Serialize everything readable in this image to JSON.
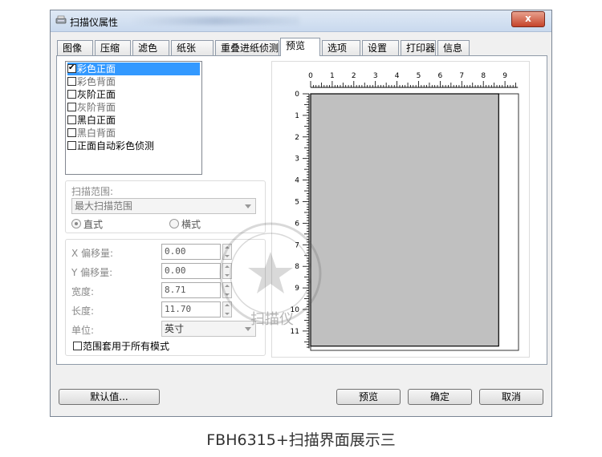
{
  "window": {
    "title": "扫描仪属性",
    "close_label": "x"
  },
  "tabs": [
    "图像",
    "压缩",
    "滤色",
    "纸张",
    "重叠进纸侦测",
    "预览",
    "选项",
    "设置",
    "打印器",
    "信息"
  ],
  "active_tab": "预览",
  "image_list": [
    {
      "label": "彩色正面",
      "checked": true,
      "selected": true,
      "enabled": true
    },
    {
      "label": "彩色背面",
      "checked": false,
      "selected": false,
      "enabled": false
    },
    {
      "label": "灰阶正面",
      "checked": false,
      "selected": false,
      "enabled": true
    },
    {
      "label": "灰阶背面",
      "checked": false,
      "selected": false,
      "enabled": false
    },
    {
      "label": "黑白正面",
      "checked": false,
      "selected": false,
      "enabled": true
    },
    {
      "label": "黑白背面",
      "checked": false,
      "selected": false,
      "enabled": false
    },
    {
      "label": "正面自动彩色侦测",
      "checked": false,
      "selected": false,
      "enabled": true
    }
  ],
  "scan_area": {
    "label": "扫描范围:",
    "value": "最大扫描范围",
    "portrait_label": "直式",
    "landscape_label": "横式",
    "orientation": "portrait"
  },
  "offsets": {
    "x_label": "X 偏移量:",
    "x_value": "0.00",
    "y_label": "Y 偏移量:",
    "y_value": "0.00",
    "width_label": "宽度:",
    "width_value": "8.71",
    "length_label": "长度:",
    "length_value": "11.70",
    "unit_label": "单位:",
    "unit_value": "英寸",
    "apply_all_label": "范围套用于所有模式",
    "apply_all_checked": false
  },
  "preview": {
    "x_ticks": [
      "0",
      "1",
      "2",
      "3",
      "4",
      "5",
      "6",
      "7",
      "8",
      "9"
    ],
    "y_ticks": [
      "0",
      "1",
      "2",
      "3",
      "4",
      "5",
      "6",
      "7",
      "8",
      "9",
      "10",
      "11"
    ],
    "area_width": 8.71,
    "area_length": 11.7,
    "max_width": 9.0,
    "max_length": 11.7,
    "area_color": "#c0c0c0"
  },
  "watermark": {
    "text": "扫描仪"
  },
  "buttons": {
    "default": "默认值...",
    "preview": "预览",
    "ok": "确定",
    "cancel": "取消"
  },
  "caption": "FBH6315+扫描界面展示三"
}
